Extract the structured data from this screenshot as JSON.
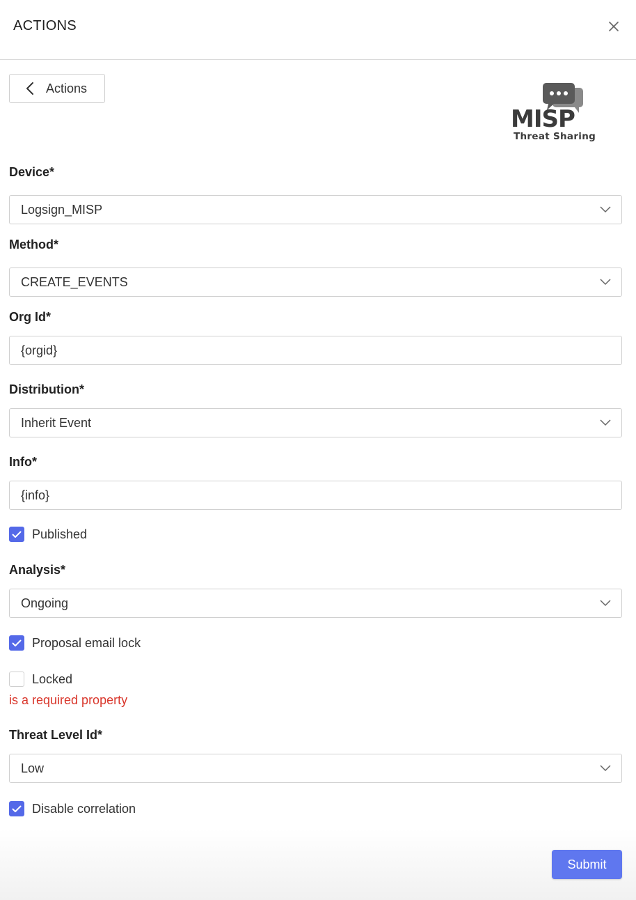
{
  "header": {
    "title": "ACTIONS",
    "close_icon": "close-icon"
  },
  "back_button": {
    "label": "Actions",
    "icon": "chevron-left-icon"
  },
  "logo": {
    "name": "MISP",
    "tagline": "Threat Sharing",
    "icon": "chat-bubbles-icon"
  },
  "fields": {
    "device": {
      "label": "Device*",
      "value": "Logsign_MISP"
    },
    "method": {
      "label": "Method*",
      "value": "CREATE_EVENTS"
    },
    "org_id": {
      "label": "Org Id*",
      "value": "{orgid}"
    },
    "distribution": {
      "label": "Distribution*",
      "value": "Inherit Event"
    },
    "info": {
      "label": "Info*",
      "value": "{info}"
    },
    "analysis": {
      "label": "Analysis*",
      "value": "Ongoing"
    },
    "threat_level": {
      "label": "Threat Level Id*",
      "value": "Low"
    }
  },
  "checkboxes": {
    "published": {
      "label": "Published",
      "checked": true
    },
    "proposal_email_lock": {
      "label": "Proposal email lock",
      "checked": true
    },
    "locked": {
      "label": "Locked",
      "checked": false,
      "error": "is a required property"
    },
    "disable_correlation": {
      "label": "Disable correlation",
      "checked": true
    }
  },
  "submit": {
    "label": "Submit"
  },
  "colors": {
    "accent": "#5469e8",
    "submit": "#5f77ef",
    "error": "#d9362b",
    "border": "#d0d0d0"
  }
}
